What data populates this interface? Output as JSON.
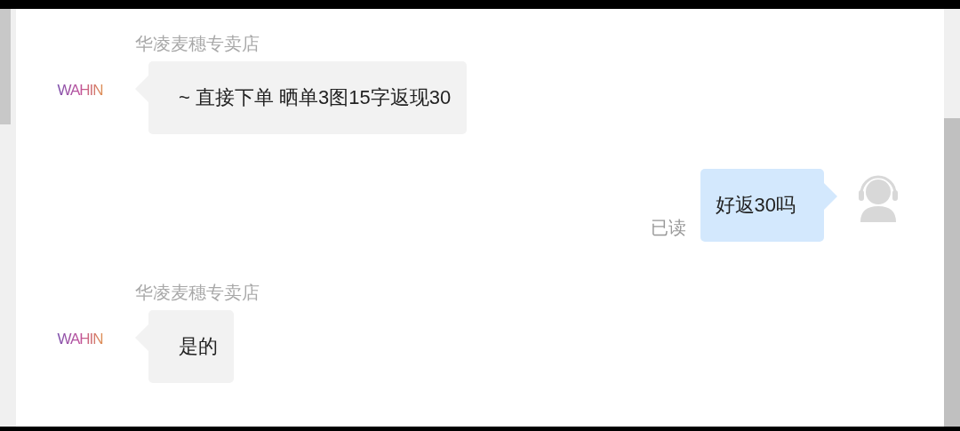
{
  "messages": [
    {
      "kind": "incoming",
      "sender": "华凌麦穗专卖店",
      "avatar_logo": "WAHIN",
      "text": "~ 直接下单 晒单3图15字返现30"
    },
    {
      "kind": "outgoing",
      "text": "好返30吗",
      "status": "已读"
    },
    {
      "kind": "incoming",
      "sender": "华凌麦穗专卖店",
      "avatar_logo": "WAHIN",
      "text": "是的"
    }
  ]
}
